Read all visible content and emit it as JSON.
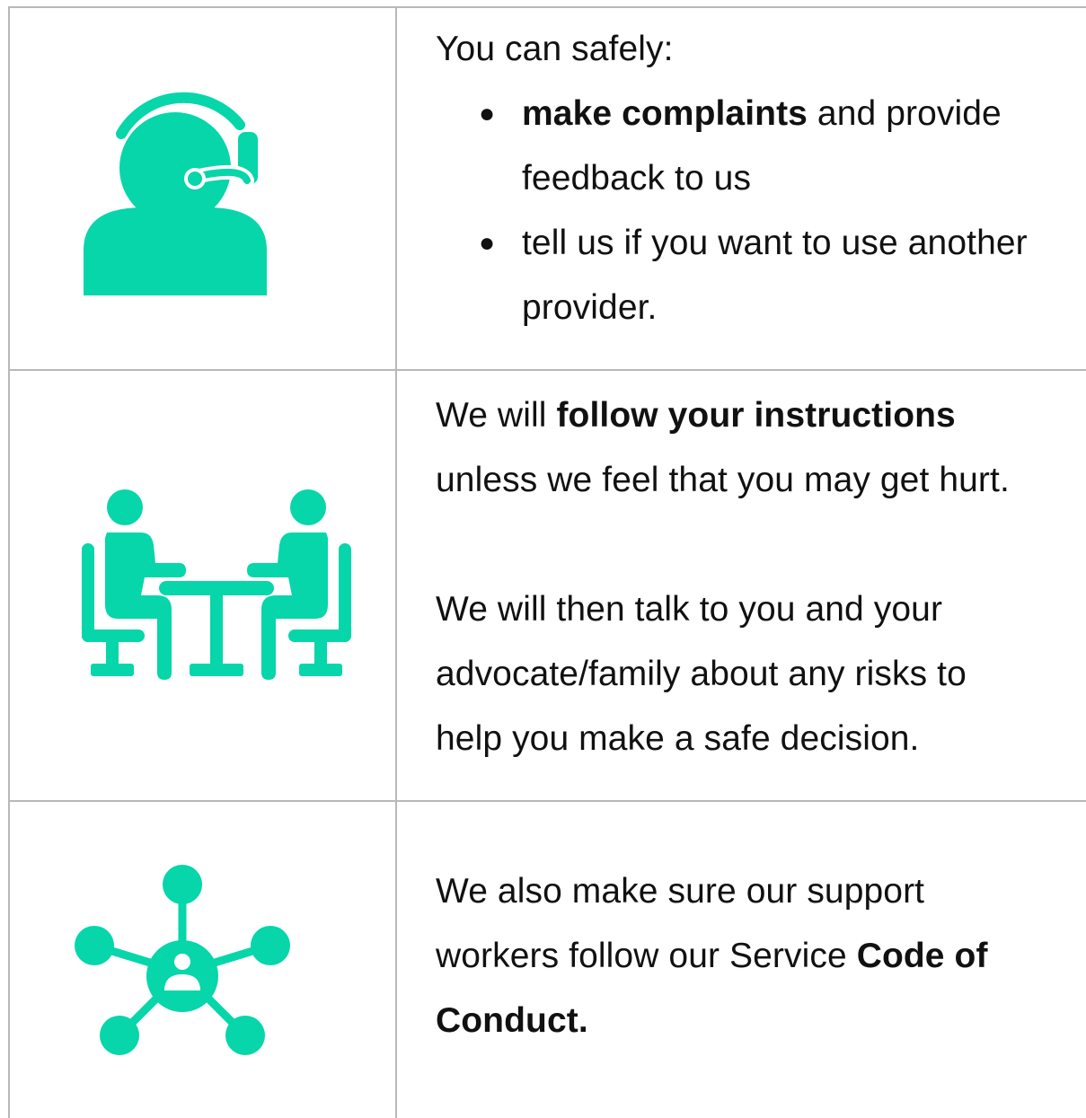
{
  "colors": {
    "accent": "#06d6a9",
    "border": "#b8b8b8",
    "text": "#111111"
  },
  "rows": [
    {
      "icon": "headset-support-icon",
      "intro": "You can safely:",
      "bullets": [
        {
          "bold": "make complaints",
          "rest_line1": " and provide",
          "rest_line2": "feedback to us"
        },
        {
          "line1": "tell us if you want to use another",
          "line2": "provider."
        }
      ]
    },
    {
      "icon": "meeting-table-icon",
      "p1_pre": "We will ",
      "p1_bold": "follow your instructions",
      "p1_line2": "unless we feel that you may get hurt.",
      "p2_line1": "We will then talk to you and your",
      "p2_line2": "advocate/family about any risks to",
      "p2_line3": "help you make a safe decision."
    },
    {
      "icon": "network-person-icon",
      "line1": "We also make sure our support",
      "line2_pre": "workers follow our Service ",
      "line2_bold": "Code of",
      "line3_bold": "Conduct."
    }
  ]
}
